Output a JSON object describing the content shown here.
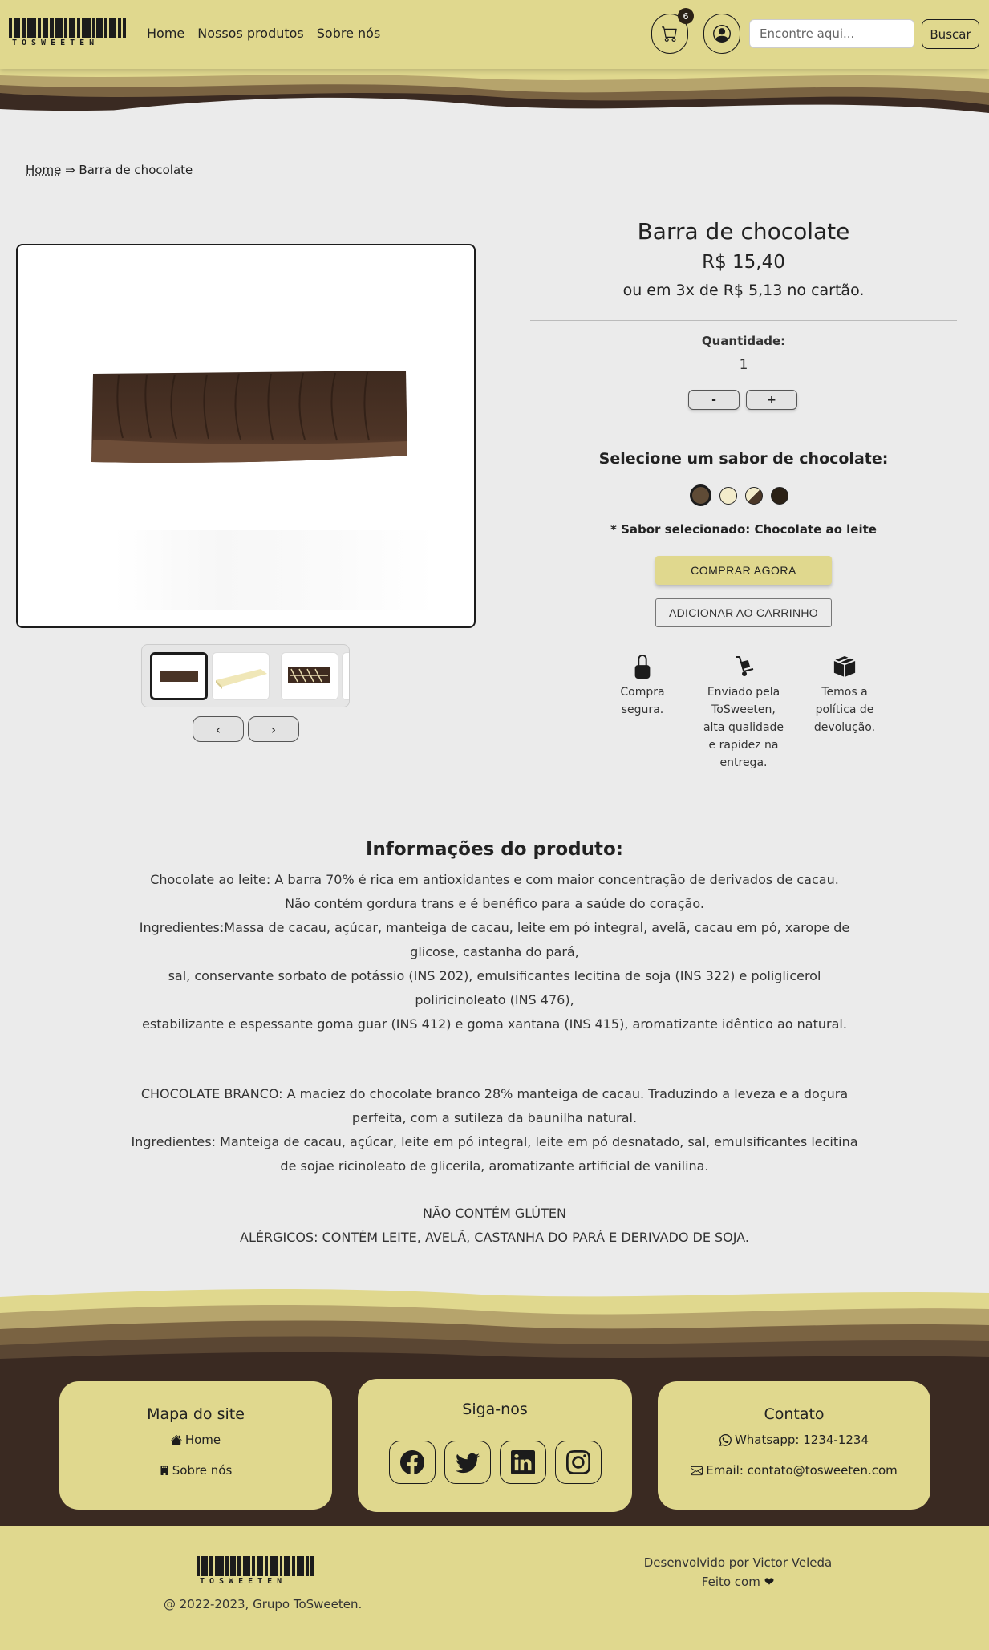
{
  "navbar": {
    "brand": "TOSWEETEN",
    "links": [
      "Home",
      "Nossos produtos",
      "Sobre nós"
    ],
    "cart_count": "6",
    "search_placeholder": "Encontre aqui...",
    "search_button": "Buscar"
  },
  "breadcrumb": {
    "home": "Home",
    "separator": " ⇒ ",
    "current": "Barra de chocolate"
  },
  "gallery": {
    "thumbnails": [
      "chocolate-ao-leite",
      "chocolate-branco",
      "chocolate-mesclado"
    ],
    "active_index": 0,
    "prev_label": "‹",
    "next_label": "›"
  },
  "product": {
    "title": "Barra de chocolate",
    "price": "R$ 15,40",
    "installments": "ou em 3x de R$ 5,13 no cartão.",
    "quantity_label": "Quantidade:",
    "quantity_value": "1",
    "minus_label": "-",
    "plus_label": "+",
    "flavor_heading": "Selecione um sabor de chocolate:",
    "flavors": [
      {
        "name": "Chocolate ao leite",
        "color": "#5f4b36",
        "selected": true
      },
      {
        "name": "Chocolate branco",
        "color": "#f3eccb",
        "selected": false
      },
      {
        "name": "Chocolate mesclado",
        "color": "#4a3727",
        "selected": false
      },
      {
        "name": "Chocolate amargo",
        "color": "#2b2116",
        "selected": false
      }
    ],
    "flavor_selected_text": "* Sabor selecionado: Chocolate ao leite",
    "buy_now": "COMPRAR AGORA",
    "add_to_cart": "ADICIONAR AO CARRINHO"
  },
  "features": [
    {
      "icon": "lock-icon",
      "text": "Compra segura."
    },
    {
      "icon": "hand-truck-icon",
      "text": "Enviado pela ToSweeten, alta qualidade e rapidez na entrega."
    },
    {
      "icon": "box-icon",
      "text": "Temos a política de devolução."
    }
  ],
  "info": {
    "title": "Informações do produto:",
    "block1": [
      "Chocolate ao leite: A barra 70% é rica em antioxidantes e com maior concentração de derivados de cacau.",
      "Não contém gordura trans e é benéfico para a saúde do coração.",
      "Ingredientes:Massa de cacau, açúcar, manteiga de cacau, leite em pó integral, avelã, cacau em pó, xarope de glicose, castanha do pará,",
      "sal, conservante sorbato de potássio (INS 202), emulsificantes lecitina de soja (INS 322) e poliglicerol poliricinoleato (INS 476),",
      "estabilizante e espessante goma guar (INS 412) e goma xantana (INS 415), aromatizante idêntico ao natural."
    ],
    "block2": [
      "CHOCOLATE BRANCO: A maciez do chocolate branco 28% manteiga de cacau. Traduzindo a leveza e a doçura perfeita, com a sutileza da baunilha natural.",
      "Ingredientes: Manteiga de cacau, açúcar, leite em pó integral, leite em pó desnatado, sal, emulsificantes lecitina de sojae ricinoleato de glicerila, aromatizante artificial de vanilina."
    ],
    "block3": [
      "NÃO CONTÉM GLÚTEN",
      "ALÉRGICOS: CONTÉM LEITE, AVELÃ, CASTANHA DO PARÁ E DERIVADO DE SOJA."
    ]
  },
  "footer": {
    "map_title": "Mapa do site",
    "map_home": "Home",
    "map_about": "Sobre nós",
    "social_title": "Siga-nos",
    "social_icons": [
      "facebook-icon",
      "twitter-icon",
      "linkedin-icon",
      "instagram-icon"
    ],
    "contact_title": "Contato",
    "whatsapp": "Whatsapp: 1234-1234",
    "email": "Email: contato@tosweeten.com",
    "brand": "TOSWEETEN",
    "copyright": "@ 2022-2023, Grupo ToSweeten.",
    "developed_by": "Desenvolvido por Victor Veleda",
    "made_with": "Feito com",
    "heart": "❤"
  },
  "colors": {
    "primary": "#e0d88e",
    "dark_brown": "#3a2a22",
    "background": "#ebebeb"
  }
}
